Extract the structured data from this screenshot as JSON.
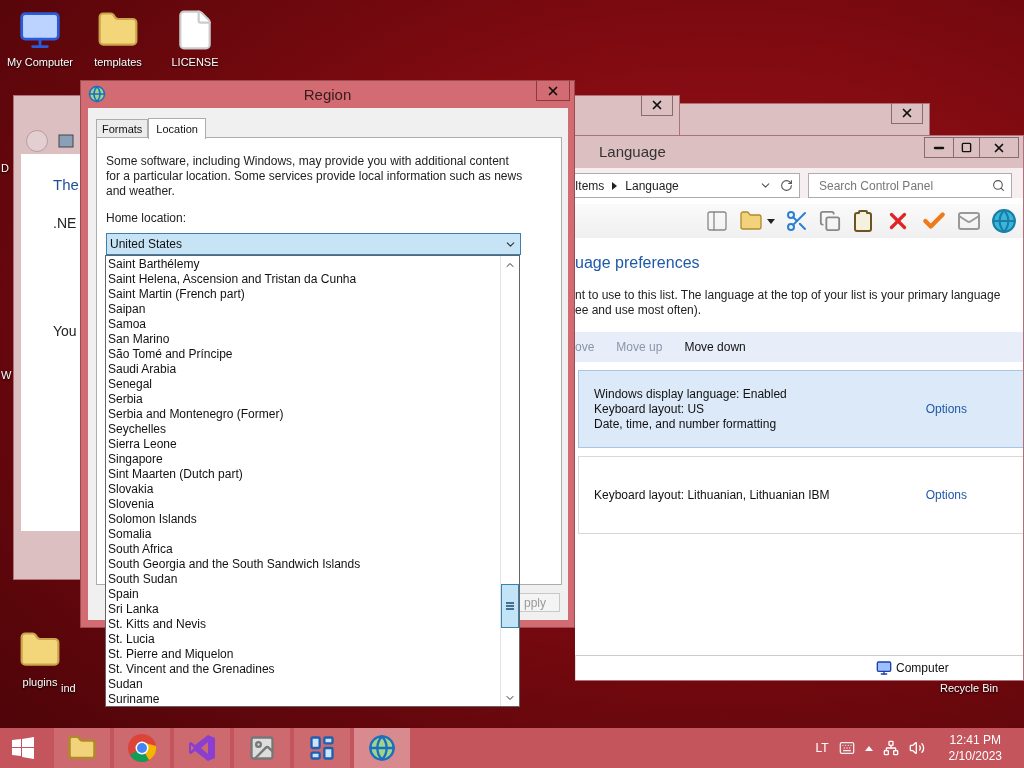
{
  "desktop_icons": [
    {
      "label": "My Computer",
      "kind": "computer"
    },
    {
      "label": "templates",
      "kind": "folder"
    },
    {
      "label": "LICENSE",
      "kind": "file"
    },
    {
      "label": "D",
      "kind": "label"
    },
    {
      "label": "W",
      "kind": "label"
    },
    {
      "label": "plugins",
      "kind": "folder"
    },
    {
      "label": "ind",
      "kind": "label"
    },
    {
      "label": "Recycle Bin",
      "kind": "label"
    }
  ],
  "back_window": {
    "lines": [
      {
        "text": "The",
        "kind": "heading"
      },
      {
        "text": ".NE",
        "kind": "body"
      },
      {
        "text": "You",
        "kind": "body"
      }
    ]
  },
  "language_window": {
    "title": "Language",
    "address": [
      "Items",
      "Language"
    ],
    "search": {
      "placeholder": "Search Control Panel"
    },
    "heading": "uage preferences",
    "description": [
      "nt to use to this list. The language at the top of your list is your primary language",
      "ee and use most often)."
    ],
    "actions": [
      {
        "label": "ove",
        "disabled": true
      },
      {
        "label": "Move up",
        "disabled": true
      },
      {
        "label": "Move down",
        "disabled": false
      }
    ],
    "languages": [
      {
        "lines": [
          "Windows display language: Enabled",
          "Keyboard layout: US",
          "Date, time, and number formatting"
        ],
        "link": "Options",
        "selected": true
      },
      {
        "lines": [
          "Keyboard layout: Lithuanian, Lithuanian IBM"
        ],
        "link": "Options",
        "selected": false
      }
    ],
    "status_bar": {
      "location": "Computer"
    }
  },
  "region_dialog": {
    "title": "Region",
    "tabs": [
      {
        "label": "Formats",
        "selected": false
      },
      {
        "label": "Location",
        "selected": true
      }
    ],
    "description": "Some software, including Windows, may provide you with additional content for a particular location. Some services provide local information such as news and weather.",
    "home_location": {
      "label": "Home location:",
      "value": "United States",
      "expanded": true,
      "options": [
        "Saint Barthélemy",
        "Saint Helena, Ascension and Tristan da Cunha",
        "Saint Martin (French part)",
        "Saipan",
        "Samoa",
        "San Marino",
        "São Tomé and Príncipe",
        "Saudi Arabia",
        "Senegal",
        "Serbia",
        "Serbia and Montenegro (Former)",
        "Seychelles",
        "Sierra Leone",
        "Singapore",
        "Sint Maarten (Dutch part)",
        "Slovakia",
        "Slovenia",
        "Solomon Islands",
        "Somalia",
        "South Africa",
        "South Georgia and the South Sandwich Islands",
        "South Sudan",
        "Spain",
        "Sri Lanka",
        "St. Kitts and Nevis",
        "St. Lucia",
        "St. Pierre and Miquelon",
        "St. Vincent and the Grenadines",
        "Sudan",
        "Suriname"
      ]
    },
    "apply_button": "pply"
  },
  "taskbar": {
    "apps": [
      {
        "kind": "explorer",
        "selected": false
      },
      {
        "kind": "chrome",
        "selected": false
      },
      {
        "kind": "studio",
        "selected": false
      },
      {
        "kind": "viewer",
        "selected": false
      },
      {
        "kind": "control",
        "selected": false
      },
      {
        "kind": "region",
        "selected": true
      }
    ],
    "tray": {
      "language": "LT",
      "time": "12:41 PM",
      "date": "2/10/2023"
    }
  }
}
